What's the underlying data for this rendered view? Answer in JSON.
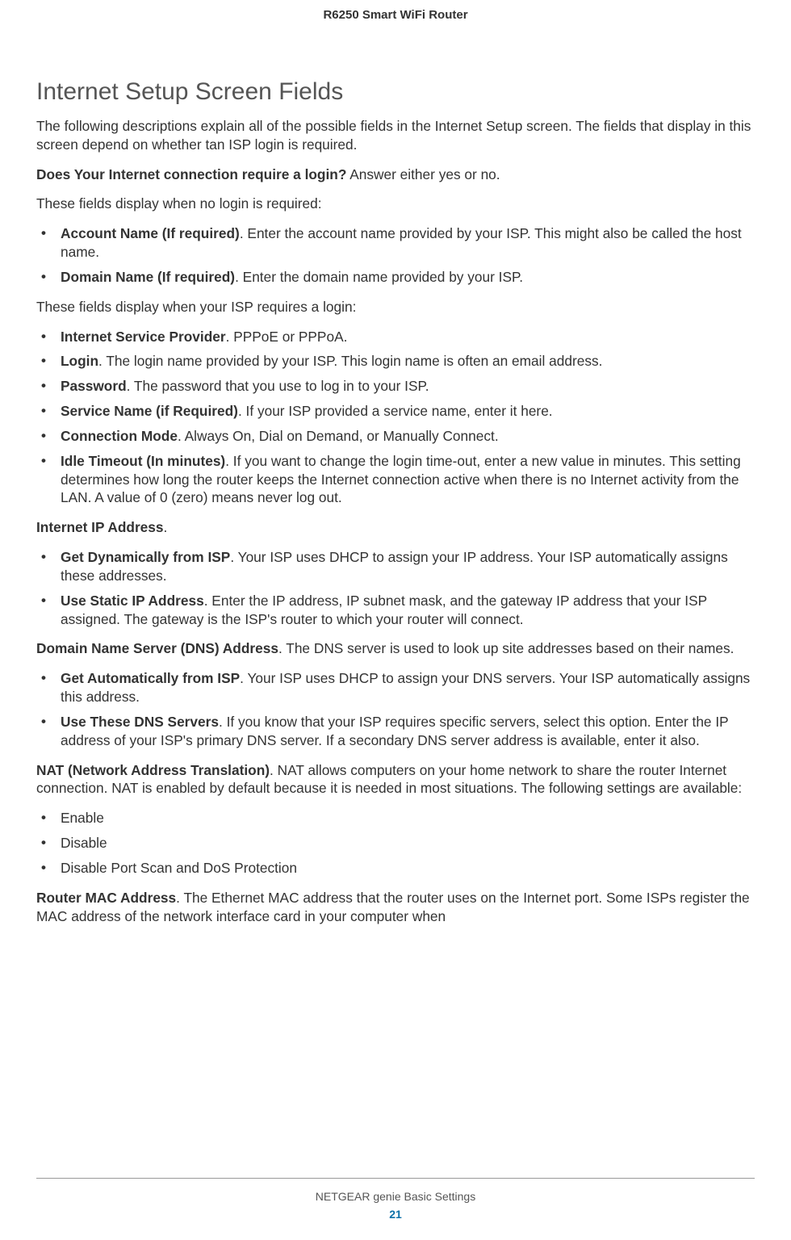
{
  "header": {
    "product": "R6250 Smart WiFi Router"
  },
  "title": "Internet Setup Screen Fields",
  "intro": "The following descriptions explain all of the possible fields in the Internet Setup screen. The fields that display in this screen depend on whether tan ISP login is required.",
  "login_q": {
    "bold": "Does Your Internet connection require a login?",
    "rest": " Answer either yes or no."
  },
  "nologin_lead": "These fields display when no login is required:",
  "nologin_items": [
    {
      "bold": "Account Name (If required)",
      "rest": ". Enter the account name provided by your ISP. This might also be called the host name."
    },
    {
      "bold": "Domain Name (If required)",
      "rest": ". Enter the domain name provided by your ISP."
    }
  ],
  "login_lead": "These fields display when your ISP requires a login:",
  "login_items": [
    {
      "bold": "Internet Service Provider",
      "rest": ". PPPoE or PPPoA."
    },
    {
      "bold": "Login",
      "rest": ". The login name provided by your ISP. This login name is often an email address."
    },
    {
      "bold": "Password",
      "rest": ". The password that you use to log in to your ISP."
    },
    {
      "bold": "Service Name (if Required)",
      "rest": ". If your ISP provided a service name, enter it here."
    },
    {
      "bold": "Connection Mode",
      "rest": ". Always On, Dial on Demand, or Manually Connect."
    },
    {
      "bold": "Idle Timeout (In minutes)",
      "rest": ". If you want to change the login time-out, enter a new value in minutes. This setting determines how long the router keeps the Internet connection active when there is no Internet activity from the LAN. A value of 0 (zero) means never log out."
    }
  ],
  "ip_heading": {
    "bold": "Internet IP Address",
    "rest": "."
  },
  "ip_items": [
    {
      "bold": "Get Dynamically from ISP",
      "rest": ". Your ISP uses DHCP to assign your IP address. Your ISP automatically assigns these addresses."
    },
    {
      "bold": "Use Static IP Address",
      "rest": ". Enter the IP address, IP subnet mask, and the gateway IP address that your ISP assigned. The gateway is the ISP's router to which your router will connect."
    }
  ],
  "dns_heading": {
    "bold": "Domain Name Server (DNS) Address",
    "rest": ". The DNS server is used to look up site addresses based on their names."
  },
  "dns_items": [
    {
      "bold": "Get Automatically from ISP",
      "rest": ". Your ISP uses DHCP to assign your DNS servers. Your ISP automatically assigns this address."
    },
    {
      "bold": "Use These DNS Servers",
      "rest": ". If you know that your ISP requires specific servers, select this option. Enter the IP address of your ISP's primary DNS server. If a secondary DNS server address is available, enter it also."
    }
  ],
  "nat_heading": {
    "bold": "NAT (Network Address Translation)",
    "rest": ". NAT allows computers on your home network to share the router Internet connection. NAT is enabled by default because it is needed in most situations. The following settings are available:"
  },
  "nat_items": [
    {
      "text": "Enable"
    },
    {
      "text": "Disable"
    },
    {
      "text": "Disable Port Scan and DoS Protection"
    }
  ],
  "mac_heading": {
    "bold": "Router MAC Address",
    "rest": ". The Ethernet MAC address that the router uses on the Internet port. Some ISPs register the MAC address of the network interface card in your computer when"
  },
  "footer": {
    "title": "NETGEAR genie Basic Settings",
    "page": "21"
  }
}
